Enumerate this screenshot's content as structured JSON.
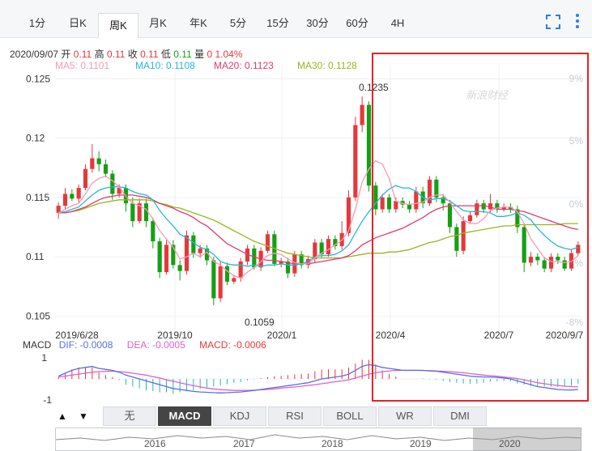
{
  "tabs": [
    "1分",
    "日K",
    "周K",
    "月K",
    "年K",
    "5分",
    "15分",
    "30分",
    "60分",
    "4H"
  ],
  "active_tab": "周K",
  "tools": {
    "fullscreen_icon": "fullscreen-icon",
    "more_icon": "more-vertical-icon"
  },
  "info": {
    "date": "2020/09/07",
    "open_label": "开",
    "open": "0.11",
    "high_label": "高",
    "high": "0.11",
    "close_label": "收",
    "close": "0.11",
    "low_label": "低",
    "low": "0.11",
    "vol_label": "量",
    "vol": "0",
    "change": "1.04%"
  },
  "ma_labels": {
    "ma5": "MA5: 0.1101",
    "ma10": "MA10: 0.1108",
    "ma20": "MA20: 0.1123",
    "ma30": "MA30: 0.1128"
  },
  "macd_labels": {
    "title": "MACD",
    "dif": "DIF: -0.0008",
    "dea": "DEA: -0.0005",
    "macd": "MACD: -0.0006"
  },
  "watermark": "新浪财经",
  "lower_tabs": [
    "无",
    "MACD",
    "KDJ",
    "RSI",
    "BOLL",
    "WR",
    "DMI"
  ],
  "lower_active": "MACD",
  "arrows": [
    "▲",
    "▼"
  ],
  "navigator_years": [
    "2016",
    "2017",
    "2018",
    "2019",
    "2020"
  ],
  "colors": {
    "up": "#e4393c",
    "down": "#14a014",
    "ma5": "#f59ab5",
    "ma10": "#29b6d8",
    "ma20": "#e03a6b",
    "ma30": "#9cb422",
    "dif": "#5a6fe0",
    "dea": "#e060d0",
    "highlight": "#e32424"
  },
  "chart_data": {
    "type": "candlestick",
    "title": "",
    "period": "weekly",
    "ylim": [
      0.104,
      0.1255
    ],
    "y_ticks_left": [
      "0.125",
      "0.12",
      "0.115",
      "0.11",
      "0.105"
    ],
    "y_ticks_right": [
      "9%",
      "5%",
      "0%",
      "-4%",
      "-8%"
    ],
    "x_tick_labels": [
      "2019/6/28",
      "2019/10",
      "2020/1",
      "2020/4",
      "2020/7",
      "2020/9/7"
    ],
    "max_label": "0.1235",
    "min_label": "0.1059",
    "macd_axis": [
      "1",
      "-1"
    ],
    "candles": [
      [
        0.1137,
        0.1143,
        0.1146,
        0.1132
      ],
      [
        0.1143,
        0.1153,
        0.1158,
        0.114
      ],
      [
        0.1153,
        0.1149,
        0.1157,
        0.1147
      ],
      [
        0.1149,
        0.1158,
        0.1161,
        0.1146
      ],
      [
        0.1158,
        0.1174,
        0.1178,
        0.1156
      ],
      [
        0.1174,
        0.1183,
        0.1195,
        0.1171
      ],
      [
        0.1183,
        0.1178,
        0.1189,
        0.1172
      ],
      [
        0.1178,
        0.117,
        0.1182,
        0.1167
      ],
      [
        0.117,
        0.1153,
        0.1173,
        0.1148
      ],
      [
        0.1153,
        0.1158,
        0.1161,
        0.115
      ],
      [
        0.1158,
        0.1145,
        0.1161,
        0.1138
      ],
      [
        0.1145,
        0.113,
        0.115,
        0.1125
      ],
      [
        0.113,
        0.1145,
        0.1149,
        0.1128
      ],
      [
        0.1145,
        0.113,
        0.1149,
        0.1125
      ],
      [
        0.113,
        0.1113,
        0.1133,
        0.1107
      ],
      [
        0.1113,
        0.1087,
        0.1116,
        0.1082
      ],
      [
        0.1087,
        0.111,
        0.1114,
        0.1085
      ],
      [
        0.111,
        0.1093,
        0.1114,
        0.109
      ],
      [
        0.1093,
        0.1088,
        0.1097,
        0.108
      ],
      [
        0.1088,
        0.1118,
        0.1122,
        0.1085
      ],
      [
        0.1118,
        0.1103,
        0.1121,
        0.1099
      ],
      [
        0.1103,
        0.1107,
        0.111,
        0.1099
      ],
      [
        0.1107,
        0.1097,
        0.111,
        0.1093
      ],
      [
        0.1097,
        0.1065,
        0.11,
        0.1059
      ],
      [
        0.1065,
        0.1092,
        0.1096,
        0.1062
      ],
      [
        0.1092,
        0.1079,
        0.1095,
        0.1076
      ],
      [
        0.1079,
        0.1082,
        0.1085,
        0.1077
      ],
      [
        0.1082,
        0.1096,
        0.1099,
        0.1079
      ],
      [
        0.1096,
        0.1107,
        0.111,
        0.1093
      ],
      [
        0.1107,
        0.1091,
        0.111,
        0.1089
      ],
      [
        0.1091,
        0.1105,
        0.1108,
        0.1088
      ],
      [
        0.1105,
        0.1119,
        0.1122,
        0.1103
      ],
      [
        0.1119,
        0.1094,
        0.1122,
        0.1092
      ],
      [
        0.1094,
        0.1096,
        0.1099,
        0.1091
      ],
      [
        0.1096,
        0.1086,
        0.1099,
        0.1082
      ],
      [
        0.1086,
        0.1102,
        0.1105,
        0.1083
      ],
      [
        0.1102,
        0.1093,
        0.1105,
        0.109
      ],
      [
        0.1093,
        0.1098,
        0.1101,
        0.109
      ],
      [
        0.1098,
        0.1112,
        0.1115,
        0.1095
      ],
      [
        0.1112,
        0.1102,
        0.1115,
        0.1099
      ],
      [
        0.1102,
        0.1115,
        0.1118,
        0.11
      ],
      [
        0.1115,
        0.1109,
        0.1118,
        0.1106
      ],
      [
        0.1109,
        0.112,
        0.113,
        0.1106
      ],
      [
        0.112,
        0.115,
        0.1156,
        0.1117
      ],
      [
        0.115,
        0.1211,
        0.1218,
        0.1147
      ],
      [
        0.1211,
        0.1228,
        0.1235,
        0.1205
      ],
      [
        0.1228,
        0.116,
        0.1231,
        0.1155
      ],
      [
        0.116,
        0.114,
        0.1163,
        0.1135
      ],
      [
        0.114,
        0.115,
        0.1153,
        0.1137
      ],
      [
        0.115,
        0.114,
        0.1153,
        0.1137
      ],
      [
        0.114,
        0.1147,
        0.115,
        0.1137
      ],
      [
        0.1147,
        0.1144,
        0.115,
        0.1141
      ],
      [
        0.1144,
        0.114,
        0.1147,
        0.1137
      ],
      [
        0.114,
        0.1155,
        0.1159,
        0.1137
      ],
      [
        0.1155,
        0.1145,
        0.1159,
        0.1141
      ],
      [
        0.1145,
        0.1165,
        0.1168,
        0.1143
      ],
      [
        0.1165,
        0.115,
        0.1168,
        0.1146
      ],
      [
        0.115,
        0.1145,
        0.1153,
        0.1139
      ],
      [
        0.1145,
        0.1125,
        0.1148,
        0.112
      ],
      [
        0.1125,
        0.1105,
        0.1128,
        0.11
      ],
      [
        0.1105,
        0.113,
        0.1134,
        0.1102
      ],
      [
        0.113,
        0.1135,
        0.1138,
        0.1128
      ],
      [
        0.1135,
        0.1145,
        0.1148,
        0.1133
      ],
      [
        0.1145,
        0.114,
        0.1148,
        0.1137
      ],
      [
        0.114,
        0.1145,
        0.1153,
        0.1137
      ],
      [
        0.1145,
        0.114,
        0.1148,
        0.1137
      ],
      [
        0.114,
        0.1142,
        0.1145,
        0.1138
      ],
      [
        0.1142,
        0.114,
        0.1145,
        0.1137
      ],
      [
        0.114,
        0.1125,
        0.1143,
        0.112
      ],
      [
        0.1125,
        0.1095,
        0.1127,
        0.1087
      ],
      [
        0.1095,
        0.11,
        0.1104,
        0.1092
      ],
      [
        0.11,
        0.1097,
        0.1103,
        0.1093
      ],
      [
        0.1097,
        0.109,
        0.11,
        0.1087
      ],
      [
        0.109,
        0.11,
        0.1103,
        0.1087
      ],
      [
        0.11,
        0.1097,
        0.1103,
        0.1094
      ],
      [
        0.1097,
        0.109,
        0.11,
        0.1088
      ],
      [
        0.109,
        0.1103,
        0.1106,
        0.1088
      ],
      [
        0.1103,
        0.111,
        0.1113,
        0.1101
      ]
    ],
    "ma5": [
      0.1137,
      0.114,
      0.1143,
      0.1145,
      0.1153,
      0.1162,
      0.1166,
      0.1168,
      0.1164,
      0.1159,
      0.1151,
      0.1145,
      0.1143,
      0.114,
      0.1132,
      0.1122,
      0.1115,
      0.1108,
      0.1098,
      0.11,
      0.1103,
      0.11,
      0.1104,
      0.1096,
      0.1093,
      0.1088,
      0.1084,
      0.1082,
      0.1087,
      0.1091,
      0.1096,
      0.1101,
      0.1103,
      0.1102,
      0.1098,
      0.1095,
      0.1094,
      0.1094,
      0.1099,
      0.1103,
      0.1106,
      0.111,
      0.1114,
      0.1122,
      0.114,
      0.1163,
      0.1174,
      0.1181,
      0.1178,
      0.1166,
      0.1147,
      0.1145,
      0.1144,
      0.1145,
      0.1146,
      0.115,
      0.1152,
      0.1152,
      0.1146,
      0.1138,
      0.1131,
      0.1128,
      0.1128,
      0.1132,
      0.1139,
      0.1141,
      0.1142,
      0.1142,
      0.1138,
      0.1128,
      0.1115,
      0.1107,
      0.1099,
      0.1096,
      0.1096,
      0.1095,
      0.1096,
      0.1101
    ],
    "ma10": [
      0.1137,
      0.1138,
      0.114,
      0.1142,
      0.1147,
      0.1152,
      0.1156,
      0.1158,
      0.1159,
      0.1159,
      0.1158,
      0.1155,
      0.1153,
      0.1152,
      0.1148,
      0.1139,
      0.1132,
      0.1126,
      0.1119,
      0.1116,
      0.1112,
      0.1108,
      0.1106,
      0.1102,
      0.1096,
      0.1094,
      0.1093,
      0.1093,
      0.1092,
      0.1093,
      0.1092,
      0.1093,
      0.1093,
      0.1094,
      0.1093,
      0.1093,
      0.1094,
      0.1096,
      0.11,
      0.1101,
      0.1101,
      0.1102,
      0.1105,
      0.111,
      0.112,
      0.113,
      0.1138,
      0.1145,
      0.1152,
      0.1157,
      0.116,
      0.1158,
      0.1158,
      0.1155,
      0.115,
      0.1148,
      0.1149,
      0.1149,
      0.1147,
      0.1143,
      0.1139,
      0.1138,
      0.1138,
      0.1138,
      0.1137,
      0.1134,
      0.1134,
      0.1135,
      0.1137,
      0.1135,
      0.1131,
      0.1124,
      0.1118,
      0.1113,
      0.1109,
      0.1107,
      0.1106,
      0.1108
    ],
    "ma20": [
      0.1137,
      0.1137,
      0.1138,
      0.114,
      0.1142,
      0.1145,
      0.1148,
      0.115,
      0.1151,
      0.1152,
      0.1152,
      0.1152,
      0.1151,
      0.115,
      0.1148,
      0.1145,
      0.1143,
      0.1141,
      0.1138,
      0.1136,
      0.1133,
      0.1129,
      0.1126,
      0.1121,
      0.1116,
      0.1111,
      0.1108,
      0.1105,
      0.1102,
      0.11,
      0.1098,
      0.1097,
      0.1097,
      0.1096,
      0.1095,
      0.1094,
      0.1094,
      0.1094,
      0.1095,
      0.1096,
      0.1097,
      0.1098,
      0.1099,
      0.1101,
      0.1105,
      0.111,
      0.1113,
      0.1116,
      0.1118,
      0.112,
      0.1122,
      0.1124,
      0.1127,
      0.113,
      0.1133,
      0.1137,
      0.114,
      0.1142,
      0.1143,
      0.1143,
      0.1143,
      0.1143,
      0.1143,
      0.1143,
      0.1142,
      0.114,
      0.114,
      0.114,
      0.1139,
      0.1138,
      0.1136,
      0.1134,
      0.1132,
      0.113,
      0.1128,
      0.1126,
      0.1124,
      0.1123
    ],
    "ma30": [
      0.1137,
      0.1137,
      0.1138,
      0.1139,
      0.1141,
      0.1143,
      0.1145,
      0.1146,
      0.1147,
      0.1148,
      0.1148,
      0.1148,
      0.1148,
      0.1148,
      0.1147,
      0.1145,
      0.1144,
      0.1142,
      0.1141,
      0.1139,
      0.1137,
      0.1135,
      0.1133,
      0.1131,
      0.1128,
      0.1125,
      0.1122,
      0.1119,
      0.1116,
      0.1113,
      0.1111,
      0.1109,
      0.1107,
      0.1105,
      0.1103,
      0.1102,
      0.1101,
      0.11,
      0.1099,
      0.1099,
      0.1099,
      0.1099,
      0.1099,
      0.11,
      0.1101,
      0.1102,
      0.1103,
      0.1103,
      0.1103,
      0.1104,
      0.1104,
      0.1105,
      0.1106,
      0.1108,
      0.111,
      0.1112,
      0.1113,
      0.1115,
      0.1117,
      0.1118,
      0.112,
      0.1121,
      0.1122,
      0.1123,
      0.1124,
      0.1125,
      0.1126,
      0.1126,
      0.1127,
      0.1127,
      0.1127,
      0.1127,
      0.1127,
      0.1127,
      0.1127,
      0.1128,
      0.1128,
      0.1128
    ],
    "macd": {
      "dif": [
        0.15,
        0.3,
        0.45,
        0.55,
        0.6,
        0.65,
        0.55,
        0.5,
        0.45,
        0.35,
        0.2,
        0.1,
        0.0,
        -0.1,
        -0.2,
        -0.3,
        -0.4,
        -0.5,
        -0.55,
        -0.6,
        -0.65,
        -0.68,
        -0.7,
        -0.72,
        -0.73,
        -0.72,
        -0.7,
        -0.68,
        -0.64,
        -0.6,
        -0.55,
        -0.5,
        -0.45,
        -0.4,
        -0.35,
        -0.3,
        -0.25,
        -0.2,
        -0.1,
        0.0,
        0.05,
        0.1,
        0.15,
        0.25,
        0.45,
        0.65,
        0.75,
        0.7,
        0.6,
        0.55,
        0.5,
        0.45,
        0.45,
        0.45,
        0.45,
        0.42,
        0.4,
        0.35,
        0.3,
        0.25,
        0.2,
        0.15,
        0.12,
        0.1,
        0.1,
        0.08,
        0.05,
        0.0,
        -0.1,
        -0.2,
        -0.3,
        -0.4,
        -0.45,
        -0.5,
        -0.55,
        -0.57,
        -0.58,
        -0.55
      ],
      "dea": [
        0.1,
        0.15,
        0.2,
        0.25,
        0.3,
        0.35,
        0.38,
        0.4,
        0.4,
        0.38,
        0.35,
        0.3,
        0.25,
        0.2,
        0.12,
        0.05,
        -0.05,
        -0.12,
        -0.2,
        -0.28,
        -0.35,
        -0.42,
        -0.48,
        -0.52,
        -0.56,
        -0.58,
        -0.6,
        -0.6,
        -0.6,
        -0.59,
        -0.57,
        -0.55,
        -0.52,
        -0.48,
        -0.45,
        -0.42,
        -0.38,
        -0.34,
        -0.3,
        -0.25,
        -0.2,
        -0.15,
        -0.1,
        -0.05,
        0.05,
        0.15,
        0.25,
        0.32,
        0.38,
        0.42,
        0.44,
        0.45,
        0.45,
        0.45,
        0.44,
        0.43,
        0.42,
        0.4,
        0.38,
        0.35,
        0.32,
        0.28,
        0.24,
        0.2,
        0.17,
        0.14,
        0.1,
        0.06,
        0.02,
        -0.05,
        -0.12,
        -0.2,
        -0.25,
        -0.3,
        -0.34,
        -0.38,
        -0.4,
        -0.42
      ],
      "hist": [
        0.1,
        0.3,
        0.5,
        0.6,
        0.6,
        0.6,
        0.34,
        0.2,
        0.1,
        -0.06,
        -0.3,
        -0.4,
        -0.5,
        -0.6,
        -0.64,
        -0.7,
        -0.7,
        -0.76,
        -0.7,
        -0.64,
        -0.6,
        -0.52,
        -0.44,
        -0.4,
        -0.34,
        -0.28,
        -0.2,
        -0.16,
        -0.08,
        -0.02,
        0.04,
        0.1,
        0.14,
        0.16,
        0.2,
        0.24,
        0.26,
        0.28,
        0.4,
        0.5,
        0.5,
        0.5,
        0.5,
        0.6,
        0.8,
        1.0,
        1.0,
        0.76,
        0.44,
        0.26,
        0.12,
        0.0,
        0.0,
        0.0,
        0.02,
        -0.02,
        -0.04,
        -0.1,
        -0.16,
        -0.2,
        -0.24,
        -0.26,
        -0.24,
        -0.2,
        -0.14,
        -0.12,
        -0.1,
        -0.12,
        -0.24,
        -0.3,
        -0.36,
        -0.4,
        -0.4,
        -0.4,
        -0.42,
        -0.38,
        -0.36,
        -0.26
      ]
    }
  }
}
